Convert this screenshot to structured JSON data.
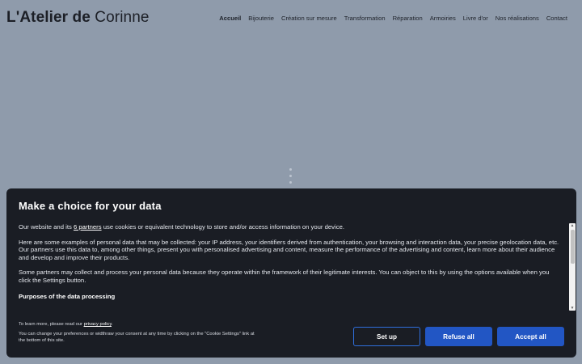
{
  "header": {
    "logo_bold": "L'Atelier de",
    "logo_thin": " Corinne",
    "nav": [
      {
        "label": "Accueil",
        "active": true
      },
      {
        "label": "Bijouterie"
      },
      {
        "label": "Création sur mesure"
      },
      {
        "label": "Transformation"
      },
      {
        "label": "Réparation"
      },
      {
        "label": "Armoiries"
      },
      {
        "label": "Livre d'or"
      },
      {
        "label": "Nos réalisations"
      },
      {
        "label": "Contact"
      }
    ]
  },
  "consent": {
    "title": "Make a choice for your data",
    "p1_before": "Our website and its ",
    "p1_link": "6 partners",
    "p1_after": " use cookies or equivalent technology to store and/or access information on your device.",
    "p2": "Here are some examples of personal data that may be collected: your IP address, your identifiers derived from authentication, your browsing and interaction data, your precise geolocation data, etc.",
    "p3": "Our partners use this data to, among other things, present you with personalised advertising and content, measure the performance of the advertising and content, learn more about their audience and develop and improve their products.",
    "p4": "Some partners may collect and process your personal data because they operate within the framework of their legitimate interests. You can object to this by using the options available when you click the Settings button.",
    "purposes_heading": "Purposes of the data processing",
    "footer_before": "To learn more, please read our ",
    "footer_link": "privacy policy",
    "footer_after": ".",
    "footer_note": "You can change your preferences or widthraw your consent at any time by clicking on the \"Cookie Settings\" link at the bottom of this site.",
    "buttons": {
      "setup": "Set up",
      "refuse": "Refuse all",
      "accept": "Accept all"
    }
  },
  "colors": {
    "page_bg": "#8f9bab",
    "dialog_bg": "#1a1d24",
    "button_blue": "#2256c4"
  }
}
